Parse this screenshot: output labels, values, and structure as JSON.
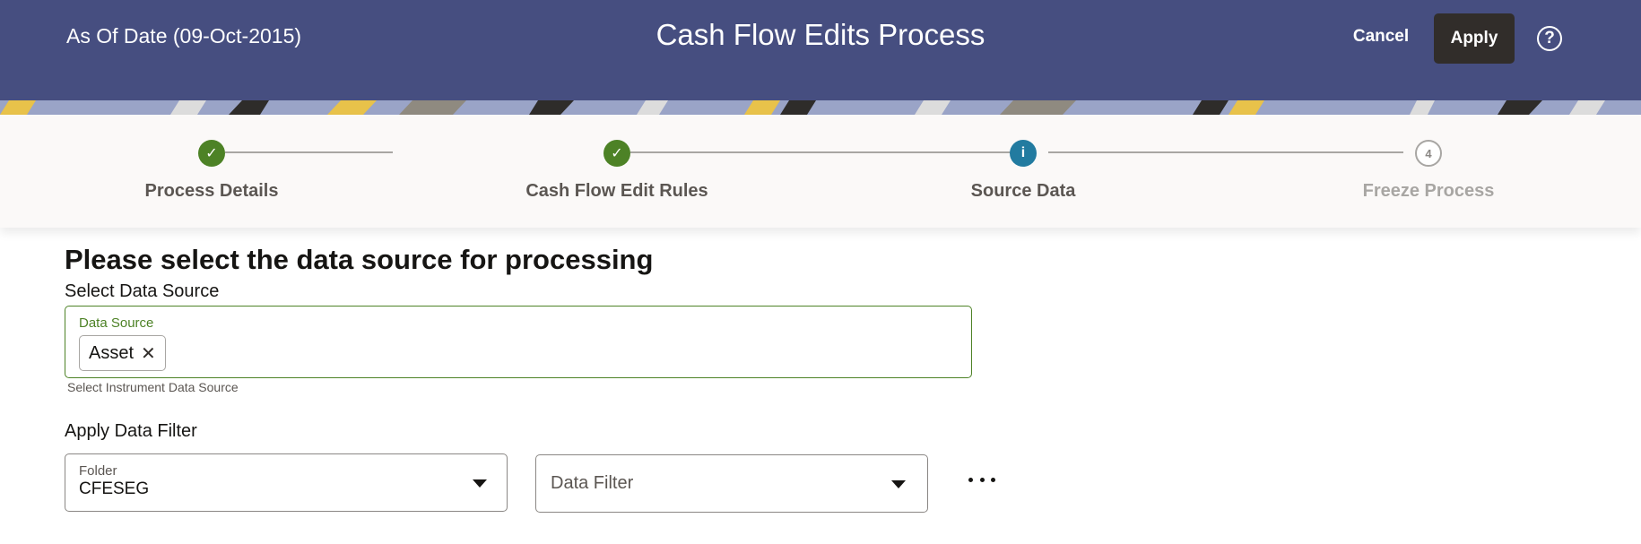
{
  "header": {
    "as_of_date": "As Of Date (09-Oct-2015)",
    "title": "Cash Flow Edits Process",
    "cancel_label": "Cancel",
    "apply_label": "Apply",
    "help_icon": "help-circle-icon",
    "help_glyph": "?",
    "background_color": "#464e80"
  },
  "train": {
    "steps": [
      {
        "label": "Process Details",
        "state": "complete",
        "glyph": "✓"
      },
      {
        "label": "Cash Flow Edit Rules",
        "state": "complete",
        "glyph": "✓"
      },
      {
        "label": "Source Data",
        "state": "current",
        "glyph": "i"
      },
      {
        "label": "Freeze Process",
        "state": "not-visited",
        "glyph": "4"
      }
    ],
    "colors": {
      "complete": "#4d8226",
      "current": "#227ba0",
      "todo": "#a8a6a3"
    }
  },
  "main": {
    "heading": "Please select the data source for processing",
    "select_data_source": {
      "section_label": "Select Data Source",
      "field_label": "Data Source",
      "chips": [
        "Asset"
      ],
      "chip_remove_glyph": "✕",
      "helper_text": "Select Instrument Data Source"
    },
    "apply_data_filter": {
      "section_label": "Apply Data Filter",
      "folder": {
        "label": "Folder",
        "value": "CFESEG"
      },
      "data_filter": {
        "placeholder": "Data Filter"
      },
      "more_icon": "ellipsis-icon"
    }
  }
}
